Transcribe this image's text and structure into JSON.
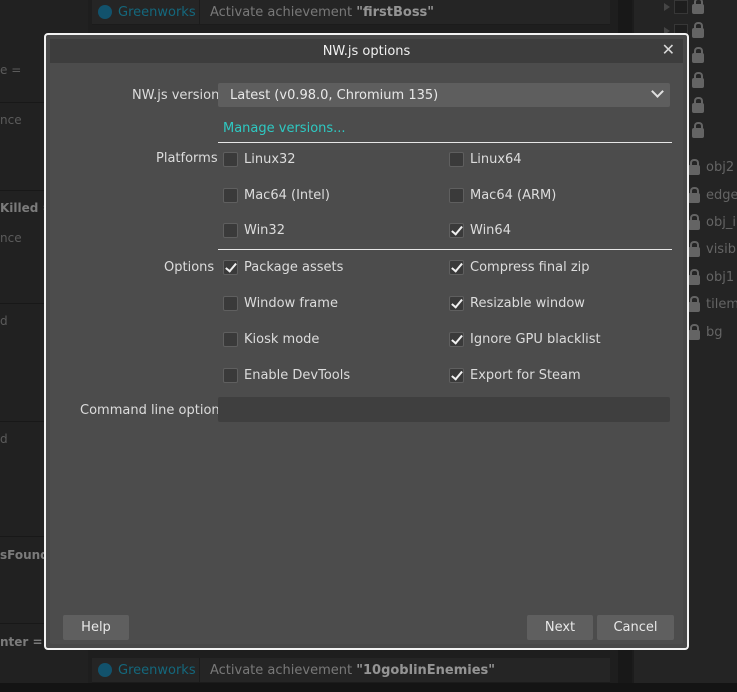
{
  "background": {
    "left_panel": {
      "fragments": [
        {
          "text": "e =",
          "bold": false
        },
        {
          "text": "nce",
          "bold": false
        },
        {
          "text": "Killed =",
          "bold": true
        },
        {
          "text": "nce",
          "bold": false
        },
        {
          "text": "d",
          "bold": false
        },
        {
          "text": "d",
          "bold": false
        },
        {
          "text": "sFound",
          "bold": true
        },
        {
          "text": "nter =",
          "bold": true
        }
      ]
    },
    "events": [
      {
        "category": "Greenworks",
        "action": "Activate achievement ",
        "value": "\"firstBoss\""
      },
      {
        "category": "Greenworks",
        "action": "Activate achievement ",
        "value": "\"10goblinEnemies\""
      }
    ],
    "layers": [
      "obj2",
      "edges",
      "obj_ir",
      "visible",
      "obj1",
      "tilema",
      "bg"
    ]
  },
  "dialog": {
    "title": "NW.js options",
    "close_glyph": "✕",
    "version": {
      "label": "NW.js version",
      "selected": "Latest (v0.98.0, Chromium 135)",
      "manage_link": "Manage versions..."
    },
    "platforms": {
      "label": "Platforms",
      "items": [
        {
          "label": "Linux32",
          "checked": false
        },
        {
          "label": "Linux64",
          "checked": false
        },
        {
          "label": "Mac64 (Intel)",
          "checked": false
        },
        {
          "label": "Mac64 (ARM)",
          "checked": false
        },
        {
          "label": "Win32",
          "checked": false
        },
        {
          "label": "Win64",
          "checked": true
        }
      ]
    },
    "options": {
      "label": "Options",
      "items": [
        {
          "label": "Package assets",
          "checked": true
        },
        {
          "label": "Compress final zip",
          "checked": true
        },
        {
          "label": "Window frame",
          "checked": false
        },
        {
          "label": "Resizable window",
          "checked": true
        },
        {
          "label": "Kiosk mode",
          "checked": false
        },
        {
          "label": "Ignore GPU blacklist",
          "checked": true
        },
        {
          "label": "Enable DevTools",
          "checked": false
        },
        {
          "label": "Export for Steam",
          "checked": true
        }
      ]
    },
    "command_line": {
      "label": "Command line options",
      "value": ""
    },
    "buttons": {
      "help": "Help",
      "next": "Next",
      "cancel": "Cancel"
    }
  }
}
